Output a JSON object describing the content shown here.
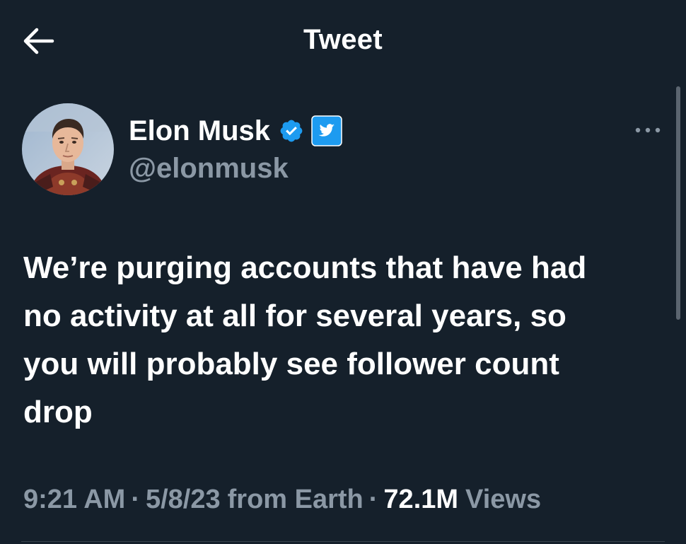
{
  "header": {
    "title": "Tweet",
    "back_icon": "arrow-left-icon"
  },
  "author": {
    "display_name": "Elon Musk",
    "handle": "@elonmusk",
    "verified_color": "#1d9bf0",
    "badges": [
      "verified-badge-icon",
      "twitter-bird-icon"
    ]
  },
  "tweet": {
    "text": "We’re purging accounts that have had\nno activity at all for several years, so\nyou will probably see follower count\ndrop"
  },
  "meta": {
    "time": "9:21 AM",
    "separator": "·",
    "date": "5/8/23",
    "source": "from Earth",
    "views_count": "72.1M",
    "views_label": "Views"
  },
  "colors": {
    "background": "#15202b",
    "secondary_text": "#8b98a5",
    "accent": "#1d9bf0"
  }
}
